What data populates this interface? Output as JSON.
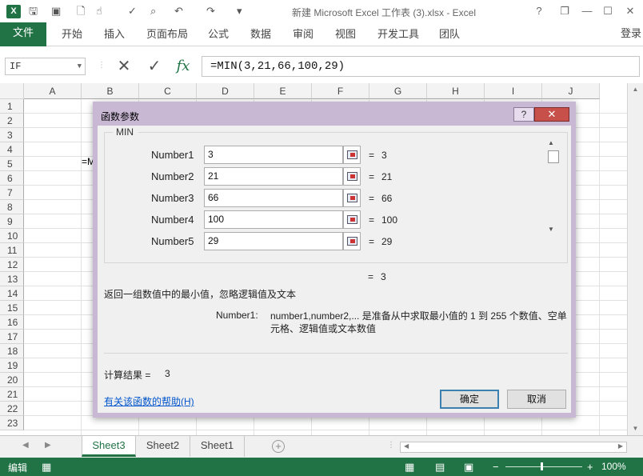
{
  "window": {
    "title": "新建 Microsoft Excel 工作表 (3).xlsx - Excel",
    "logo": "X",
    "help_glyph": "?",
    "restore_glyph": "❐",
    "minimize_glyph": "—",
    "maximize_glyph": "☐",
    "close_glyph": "✕"
  },
  "ribbon": {
    "tabs": [
      "文件",
      "开始",
      "插入",
      "页面布局",
      "公式",
      "数据",
      "审阅",
      "视图",
      "开发工具",
      "团队"
    ],
    "sign_in": "登录"
  },
  "formula_bar": {
    "name_box": "IF",
    "cancel_glyph": "✕",
    "enter_glyph": "✓",
    "fx_glyph": "fx",
    "formula": "=MIN(3,21,66,100,29)"
  },
  "grid": {
    "columns": [
      "A",
      "B",
      "C",
      "D",
      "E",
      "F",
      "G",
      "H",
      "I",
      "J"
    ],
    "rows": [
      "1",
      "2",
      "3",
      "4",
      "5",
      "6",
      "7",
      "8",
      "9",
      "10",
      "11",
      "12",
      "13",
      "14",
      "15",
      "16",
      "17",
      "18",
      "19",
      "20",
      "21",
      "22",
      "23"
    ],
    "cell_b5": "=M"
  },
  "sheets": {
    "tabs": [
      "Sheet3",
      "Sheet2",
      "Sheet1"
    ],
    "active": "Sheet3",
    "add_glyph": "+"
  },
  "status": {
    "mode": "编辑",
    "zoom": "100%",
    "zoom_minus": "−",
    "zoom_plus": "+"
  },
  "dialog": {
    "title": "函数参数",
    "help_glyph": "?",
    "close_glyph": "✕",
    "function_name": "MIN",
    "args": [
      {
        "label": "Number1",
        "value": "3",
        "result": "3"
      },
      {
        "label": "Number2",
        "value": "21",
        "result": "21"
      },
      {
        "label": "Number3",
        "value": "66",
        "result": "66"
      },
      {
        "label": "Number4",
        "value": "100",
        "result": "100"
      },
      {
        "label": "Number5",
        "value": "29",
        "result": "29"
      }
    ],
    "eq": "=",
    "overall_result": "3",
    "function_description": "返回一组数值中的最小值，忽略逻辑值及文本",
    "arg_desc_label": "Number1:",
    "arg_desc_text": "number1,number2,... 是准备从中求取最小值的 1 到 255 个数值、空单元格、逻辑值或文本数值",
    "calc_label": "计算结果 =",
    "calc_value": "3",
    "help_link": "有关该函数的帮助(H)",
    "ok": "确定",
    "cancel": "取消"
  }
}
